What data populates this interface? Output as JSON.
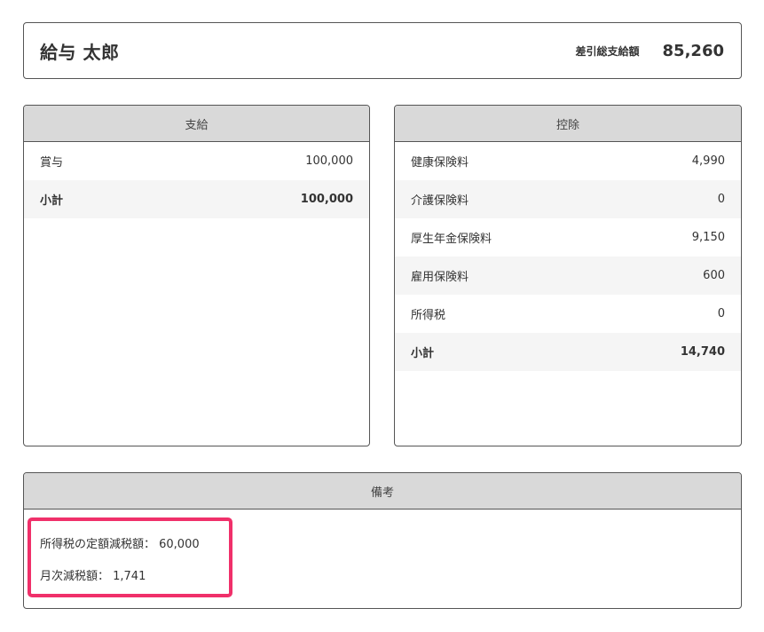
{
  "header": {
    "employee_name": "給与 太郎",
    "net_pay_label": "差引総支給額",
    "net_pay_value": "85,260"
  },
  "payments": {
    "title": "支給",
    "rows": [
      {
        "label": "賞与",
        "value": "100,000"
      }
    ],
    "subtotal": {
      "label": "小計",
      "value": "100,000"
    }
  },
  "deductions": {
    "title": "控除",
    "rows": [
      {
        "label": "健康保険料",
        "value": "4,990"
      },
      {
        "label": "介護保険料",
        "value": "0"
      },
      {
        "label": "厚生年金保険料",
        "value": "9,150"
      },
      {
        "label": "雇用保険料",
        "value": "600"
      },
      {
        "label": "所得税",
        "value": "0"
      }
    ],
    "subtotal": {
      "label": "小計",
      "value": "14,740"
    }
  },
  "notes": {
    "title": "備考",
    "lines": [
      "所得税の定額減税額： 60,000",
      "月次減税額： 1,741"
    ]
  },
  "colors": {
    "highlight": "#f0306a",
    "panel_header_bg": "#d9d9d9",
    "alt_row_bg": "#f5f5f5"
  }
}
